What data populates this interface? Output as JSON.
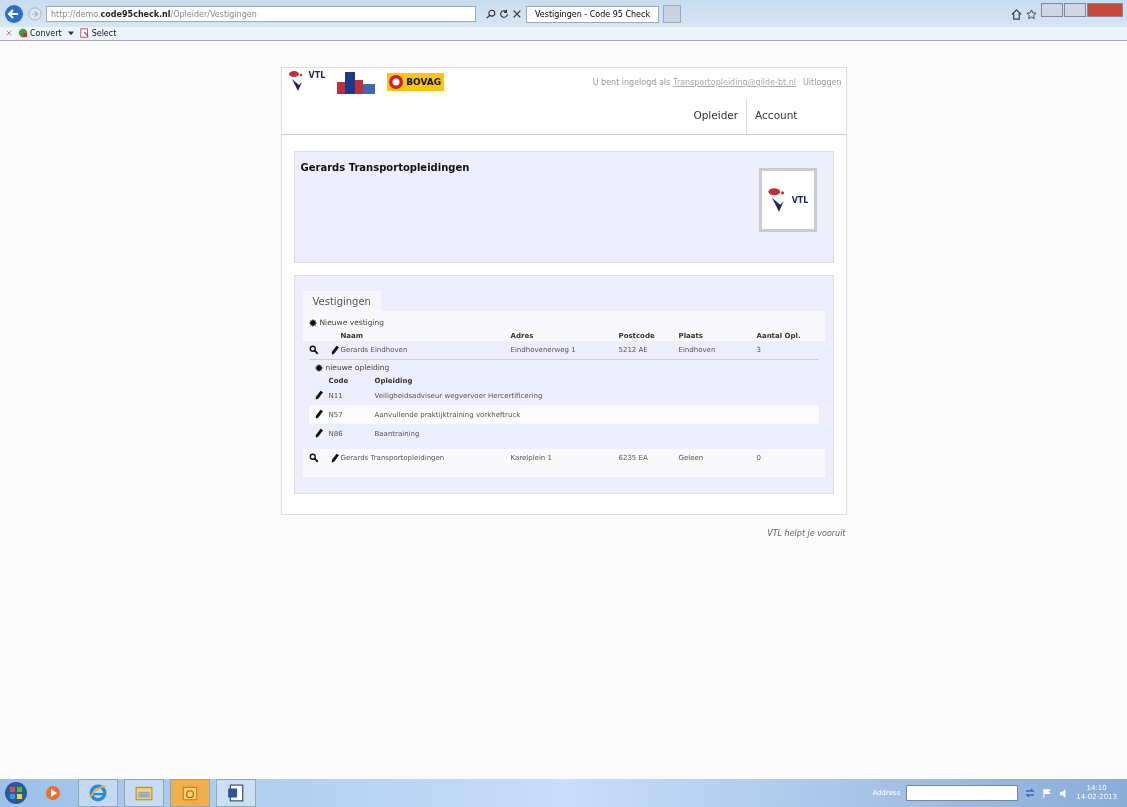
{
  "browser": {
    "address": "http://demo.**code95check.nl**/Opleider/Vestigingen",
    "tabs": [
      {
        "title": "Vestigingen - Code 95 Check",
        "selected": true
      }
    ],
    "command_bar": [
      {
        "kind": "convert",
        "label": "Convert"
      },
      {
        "kind": "select",
        "label": "Select"
      }
    ]
  },
  "header": {
    "logos": [
      {
        "kind": "vtl",
        "text": "VTL"
      },
      {
        "kind": "tln"
      },
      {
        "kind": "bovag",
        "text": "BOVAG"
      }
    ],
    "login_text": "U bent ingelogd als",
    "user_link": "Transportopleiding@gilde-bt.nl",
    "logout": "Uitloggen",
    "nav": [
      {
        "label": "Opleider"
      },
      {
        "label": "Account"
      }
    ]
  },
  "company": {
    "name": "Gerards Transportopleidingen",
    "logo_text": "VTL"
  },
  "branches": {
    "tab": "Vestigingen",
    "new_branch": "Nieuwe vestiging",
    "columns": [
      "Naam",
      "Adres",
      "Postcode",
      "Plaats",
      "Aantal Opl."
    ],
    "rows": [
      {
        "name": "Gerards Eindhoven",
        "address": "Eindhovenerweg 1",
        "postcode": "5212 AE",
        "city": "Eindhoven",
        "count": "3",
        "expanded": true,
        "new_course": "nieuwe opleiding",
        "course_columns": [
          "Code",
          "Opleiding"
        ],
        "courses": [
          {
            "code": "N11",
            "name": "Veiligheidsadviseur wegvervoer Hercertificering"
          },
          {
            "code": "N57",
            "name": "Aanvullende praktijktraining vorkheftruck"
          },
          {
            "code": "N86",
            "name": "Baantraining"
          }
        ]
      },
      {
        "name": "Gerards Transportopleidingen",
        "address": "Karelplein 1",
        "postcode": "6235 EA",
        "city": "Geleen",
        "count": "0",
        "expanded": false
      }
    ]
  },
  "footer": "VTL helpt je vooruit",
  "taskbar": {
    "apps": [
      {
        "kind": "media"
      },
      {
        "kind": "ie"
      },
      {
        "kind": "folder"
      },
      {
        "kind": "outlook"
      },
      {
        "kind": "word"
      }
    ],
    "address_label": "Address",
    "time": "14:10",
    "date": "14-02-2013"
  }
}
